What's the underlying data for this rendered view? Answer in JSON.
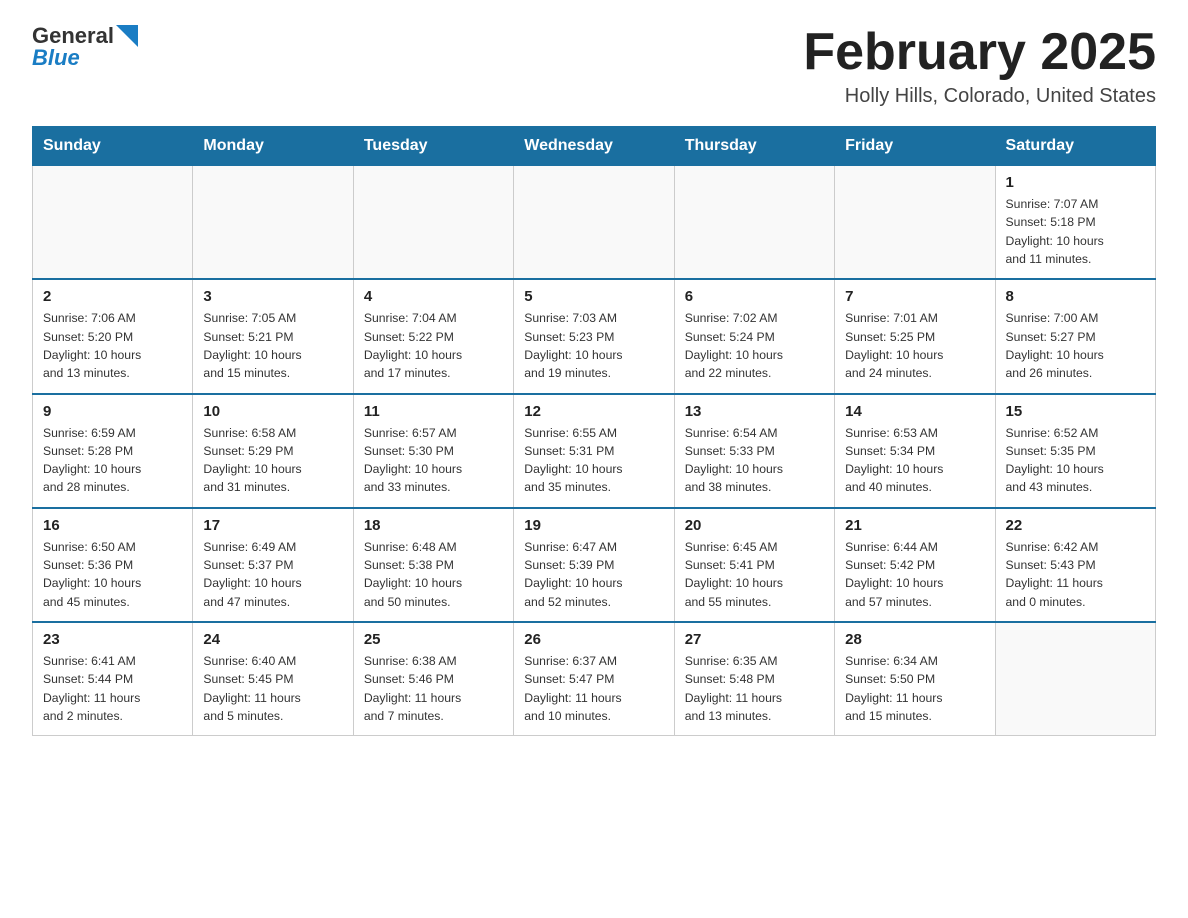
{
  "header": {
    "logo_text_general": "General",
    "logo_text_blue": "Blue",
    "month_title": "February 2025",
    "location": "Holly Hills, Colorado, United States"
  },
  "weekdays": [
    "Sunday",
    "Monday",
    "Tuesday",
    "Wednesday",
    "Thursday",
    "Friday",
    "Saturday"
  ],
  "weeks": [
    [
      {
        "day": "",
        "info": ""
      },
      {
        "day": "",
        "info": ""
      },
      {
        "day": "",
        "info": ""
      },
      {
        "day": "",
        "info": ""
      },
      {
        "day": "",
        "info": ""
      },
      {
        "day": "",
        "info": ""
      },
      {
        "day": "1",
        "info": "Sunrise: 7:07 AM\nSunset: 5:18 PM\nDaylight: 10 hours\nand 11 minutes."
      }
    ],
    [
      {
        "day": "2",
        "info": "Sunrise: 7:06 AM\nSunset: 5:20 PM\nDaylight: 10 hours\nand 13 minutes."
      },
      {
        "day": "3",
        "info": "Sunrise: 7:05 AM\nSunset: 5:21 PM\nDaylight: 10 hours\nand 15 minutes."
      },
      {
        "day": "4",
        "info": "Sunrise: 7:04 AM\nSunset: 5:22 PM\nDaylight: 10 hours\nand 17 minutes."
      },
      {
        "day": "5",
        "info": "Sunrise: 7:03 AM\nSunset: 5:23 PM\nDaylight: 10 hours\nand 19 minutes."
      },
      {
        "day": "6",
        "info": "Sunrise: 7:02 AM\nSunset: 5:24 PM\nDaylight: 10 hours\nand 22 minutes."
      },
      {
        "day": "7",
        "info": "Sunrise: 7:01 AM\nSunset: 5:25 PM\nDaylight: 10 hours\nand 24 minutes."
      },
      {
        "day": "8",
        "info": "Sunrise: 7:00 AM\nSunset: 5:27 PM\nDaylight: 10 hours\nand 26 minutes."
      }
    ],
    [
      {
        "day": "9",
        "info": "Sunrise: 6:59 AM\nSunset: 5:28 PM\nDaylight: 10 hours\nand 28 minutes."
      },
      {
        "day": "10",
        "info": "Sunrise: 6:58 AM\nSunset: 5:29 PM\nDaylight: 10 hours\nand 31 minutes."
      },
      {
        "day": "11",
        "info": "Sunrise: 6:57 AM\nSunset: 5:30 PM\nDaylight: 10 hours\nand 33 minutes."
      },
      {
        "day": "12",
        "info": "Sunrise: 6:55 AM\nSunset: 5:31 PM\nDaylight: 10 hours\nand 35 minutes."
      },
      {
        "day": "13",
        "info": "Sunrise: 6:54 AM\nSunset: 5:33 PM\nDaylight: 10 hours\nand 38 minutes."
      },
      {
        "day": "14",
        "info": "Sunrise: 6:53 AM\nSunset: 5:34 PM\nDaylight: 10 hours\nand 40 minutes."
      },
      {
        "day": "15",
        "info": "Sunrise: 6:52 AM\nSunset: 5:35 PM\nDaylight: 10 hours\nand 43 minutes."
      }
    ],
    [
      {
        "day": "16",
        "info": "Sunrise: 6:50 AM\nSunset: 5:36 PM\nDaylight: 10 hours\nand 45 minutes."
      },
      {
        "day": "17",
        "info": "Sunrise: 6:49 AM\nSunset: 5:37 PM\nDaylight: 10 hours\nand 47 minutes."
      },
      {
        "day": "18",
        "info": "Sunrise: 6:48 AM\nSunset: 5:38 PM\nDaylight: 10 hours\nand 50 minutes."
      },
      {
        "day": "19",
        "info": "Sunrise: 6:47 AM\nSunset: 5:39 PM\nDaylight: 10 hours\nand 52 minutes."
      },
      {
        "day": "20",
        "info": "Sunrise: 6:45 AM\nSunset: 5:41 PM\nDaylight: 10 hours\nand 55 minutes."
      },
      {
        "day": "21",
        "info": "Sunrise: 6:44 AM\nSunset: 5:42 PM\nDaylight: 10 hours\nand 57 minutes."
      },
      {
        "day": "22",
        "info": "Sunrise: 6:42 AM\nSunset: 5:43 PM\nDaylight: 11 hours\nand 0 minutes."
      }
    ],
    [
      {
        "day": "23",
        "info": "Sunrise: 6:41 AM\nSunset: 5:44 PM\nDaylight: 11 hours\nand 2 minutes."
      },
      {
        "day": "24",
        "info": "Sunrise: 6:40 AM\nSunset: 5:45 PM\nDaylight: 11 hours\nand 5 minutes."
      },
      {
        "day": "25",
        "info": "Sunrise: 6:38 AM\nSunset: 5:46 PM\nDaylight: 11 hours\nand 7 minutes."
      },
      {
        "day": "26",
        "info": "Sunrise: 6:37 AM\nSunset: 5:47 PM\nDaylight: 11 hours\nand 10 minutes."
      },
      {
        "day": "27",
        "info": "Sunrise: 6:35 AM\nSunset: 5:48 PM\nDaylight: 11 hours\nand 13 minutes."
      },
      {
        "day": "28",
        "info": "Sunrise: 6:34 AM\nSunset: 5:50 PM\nDaylight: 11 hours\nand 15 minutes."
      },
      {
        "day": "",
        "info": ""
      }
    ]
  ]
}
